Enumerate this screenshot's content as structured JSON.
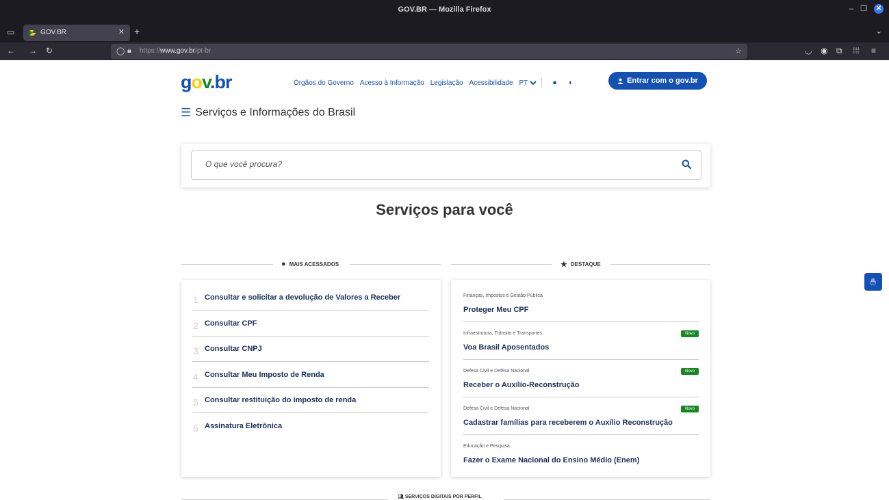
{
  "browser": {
    "window_title": "GOV.BR — Mozilla Firefox",
    "tab_title": "GOV.BR",
    "new_tab_label": "+",
    "url": {
      "protocol": "https://",
      "host": "www.gov.br",
      "path": "/pt-br"
    }
  },
  "header": {
    "logo": {
      "g": "g",
      "o": "o",
      "v": "v",
      "dot": ".",
      "br": "br"
    },
    "nav_links": [
      "Órgãos do Governo",
      "Acesso à Informação",
      "Legislação",
      "Acessibilidade"
    ],
    "language": "PT",
    "login_label": "Entrar com o gov.br",
    "menu_title": "Serviços e Informações do Brasil"
  },
  "search": {
    "placeholder": "O que você procura?"
  },
  "main": {
    "heading": "Serviços para você",
    "most_accessed": {
      "label": "MAIS ACESSADOS",
      "items": [
        {
          "rank": "1",
          "title": "Consultar e solicitar a devolução de Valores a Receber"
        },
        {
          "rank": "2",
          "title": "Consultar CPF"
        },
        {
          "rank": "3",
          "title": "Consultar CNPJ"
        },
        {
          "rank": "4",
          "title": "Consultar Meu Imposto de Renda"
        },
        {
          "rank": "5",
          "title": "Consultar restituição do imposto de renda"
        },
        {
          "rank": "6",
          "title": "Assinatura Eletrônica"
        }
      ]
    },
    "highlights": {
      "label": "DESTAQUE",
      "items": [
        {
          "category": "Finanças, Impostos e Gestão Pública",
          "title": "Proteger Meu CPF",
          "badge": ""
        },
        {
          "category": "Infraestrutura, Trânsito e Transportes",
          "title": "Voa Brasil Aposentados",
          "badge": "Novo"
        },
        {
          "category": "Defesa Civil e Defesa Nacional",
          "title": "Receber o Auxílio-Reconstrução",
          "badge": "Novo"
        },
        {
          "category": "Defesa Civil e Defesa Nacional",
          "title": "Cadastrar famílias para receberem o Auxílio Reconstrução",
          "badge": "Novo"
        },
        {
          "category": "Educação e Pesquisa",
          "title": "Fazer o Exame Nacional do Ensino Médio (Enem)",
          "badge": ""
        }
      ]
    },
    "bottom_section_label": "SERVIÇOS DIGITAIS POR PERFIL"
  },
  "colors": {
    "primary": "#1351b4",
    "new_badge": "#168821",
    "logo_yellow": "#ffcd07",
    "logo_green": "#168821"
  },
  "icons": [
    "tab-list-icon",
    "gov-favicon-icon",
    "tab-close-icon",
    "back-arrow-icon",
    "forward-arrow-icon",
    "reload-icon",
    "shield-icon",
    "lock-icon",
    "bookmark-star-icon",
    "pocket-icon",
    "account-icon",
    "extensions-icon",
    "apps-grid-icon",
    "hamburger-menu-icon",
    "chevron-down-icon",
    "color-contrast-icon",
    "user-icon",
    "search-icon",
    "fire-icon",
    "star-icon",
    "vlibras-hands-icon"
  ]
}
